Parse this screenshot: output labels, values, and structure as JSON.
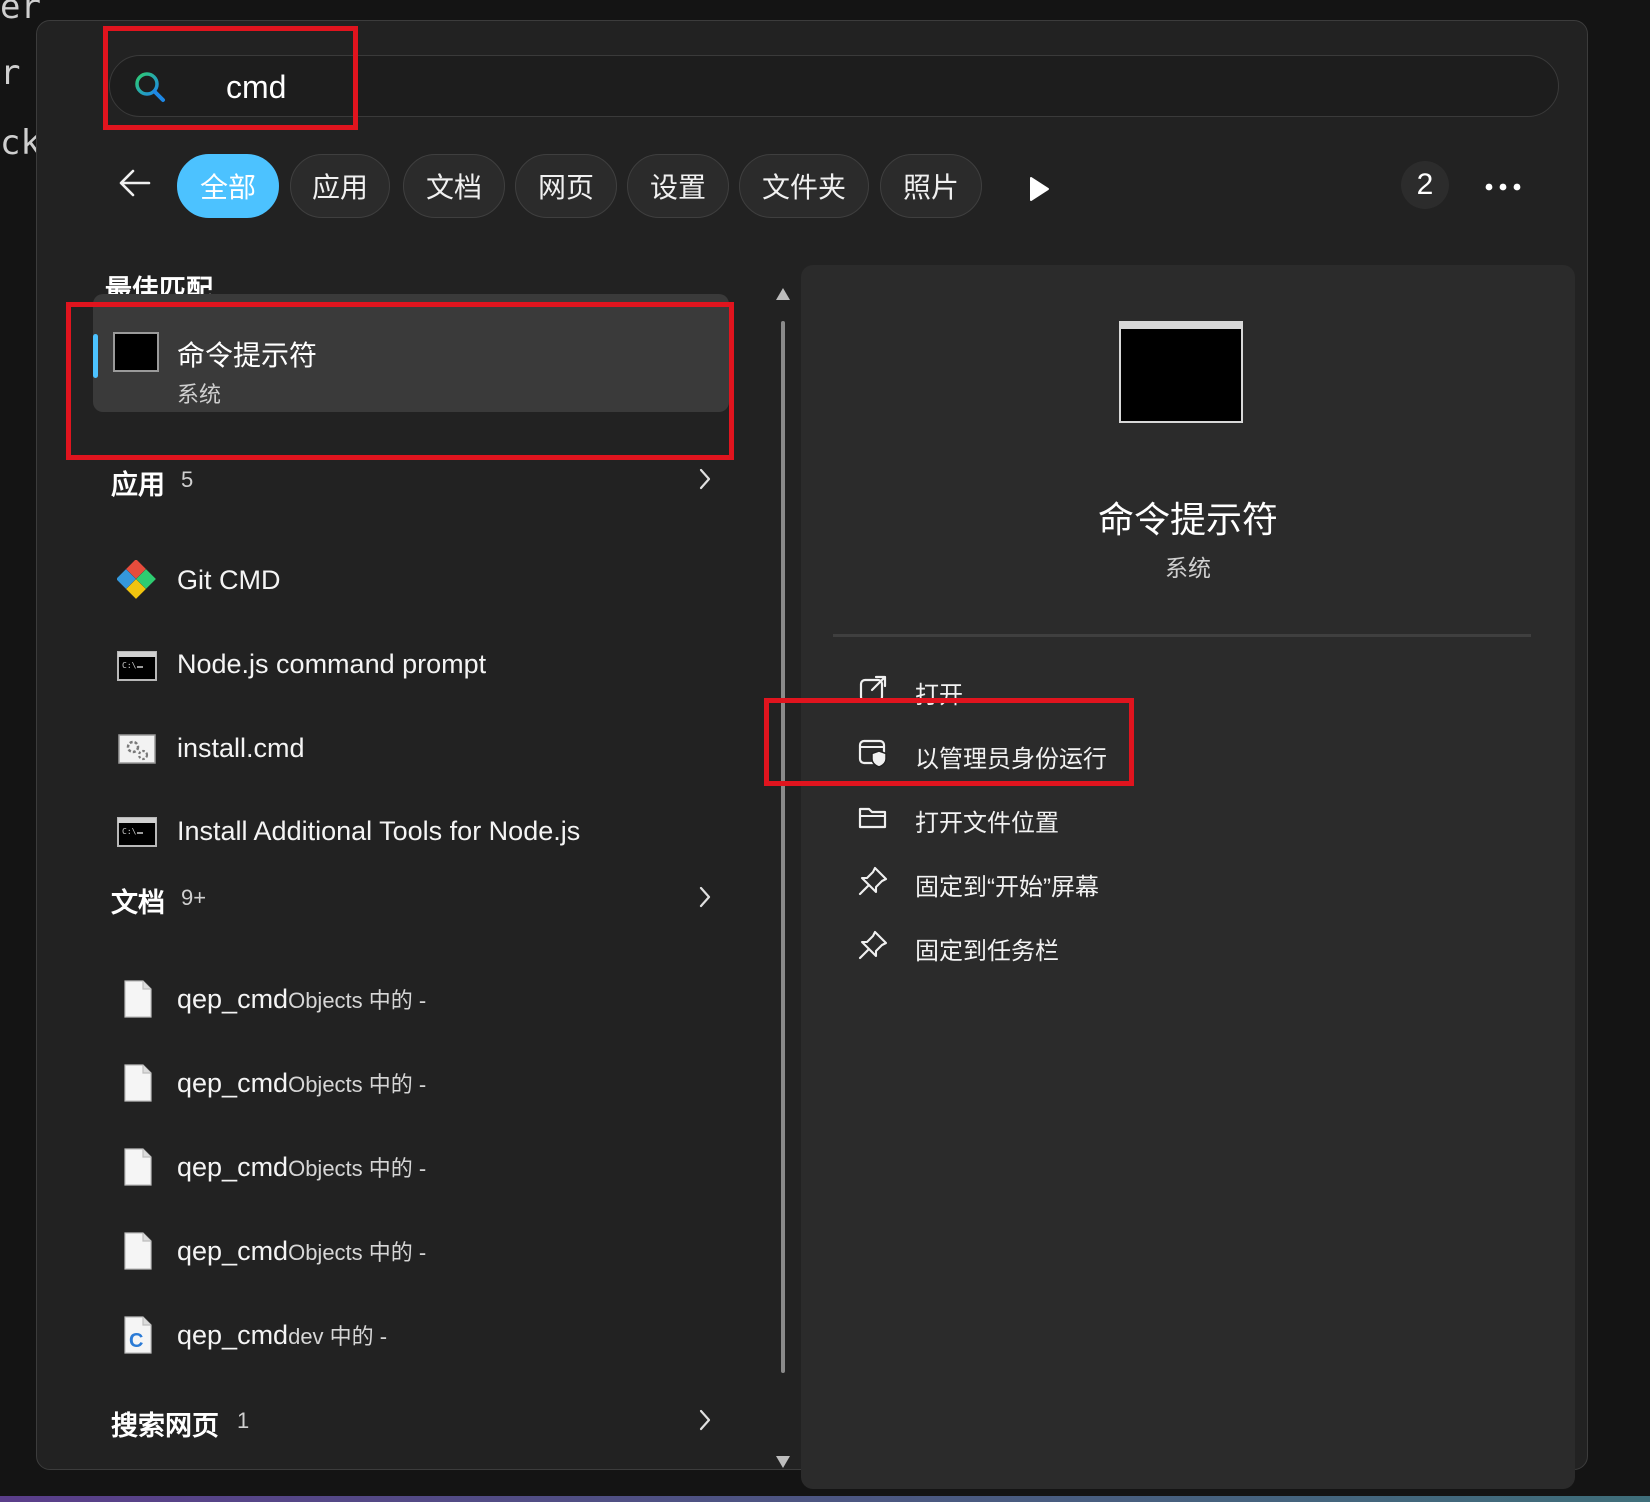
{
  "search": {
    "query": "cmd"
  },
  "filters": {
    "tabs": [
      {
        "label": "全部",
        "active": true
      },
      {
        "label": "应用"
      },
      {
        "label": "文档"
      },
      {
        "label": "网页"
      },
      {
        "label": "设置"
      },
      {
        "label": "文件夹"
      },
      {
        "label": "照片"
      }
    ],
    "count_badge": "2"
  },
  "best_match": {
    "header": "最佳匹配",
    "title": "命令提示符",
    "subtitle": "系统"
  },
  "apps": {
    "header": "应用",
    "count": "5",
    "items": [
      {
        "label": "Git CMD",
        "icon": "git-icon"
      },
      {
        "label": "Node.js command prompt",
        "icon": "console-icon"
      },
      {
        "label": "install.cmd",
        "icon": "script-settings-icon"
      },
      {
        "label": "Install Additional Tools for Node.js",
        "icon": "console-icon"
      }
    ]
  },
  "documents": {
    "header": "文档",
    "count": "9+",
    "items": [
      {
        "name": "qep_cmd",
        "suffix": "Objects 中的 -",
        "icon": "document-icon"
      },
      {
        "name": "qep_cmd",
        "suffix": "Objects 中的 -",
        "icon": "document-icon"
      },
      {
        "name": "qep_cmd",
        "suffix": "Objects 中的 -",
        "icon": "document-icon"
      },
      {
        "name": "qep_cmd",
        "suffix": "Objects 中的 -",
        "icon": "document-icon"
      },
      {
        "name": "qep_cmd",
        "suffix": "dev 中的 -",
        "icon": "c-source-file-icon"
      }
    ]
  },
  "web_search": {
    "header": "搜索网页",
    "count": "1"
  },
  "detail": {
    "title": "命令提示符",
    "subtitle": "系统",
    "actions": [
      {
        "label": "打开",
        "icon": "open-external-icon"
      },
      {
        "label": "以管理员身份运行",
        "icon": "shield-admin-icon"
      },
      {
        "label": "打开文件位置",
        "icon": "folder-icon"
      },
      {
        "label": "固定到“开始”屏幕",
        "icon": "pin-icon"
      },
      {
        "label": "固定到任务栏",
        "icon": "pin-icon"
      }
    ]
  },
  "background_text": [
    "er",
    "r",
    "ck"
  ],
  "colors": {
    "accent": "#4cc2ff",
    "highlight_box": "#e0141e",
    "panel": "#222222"
  }
}
